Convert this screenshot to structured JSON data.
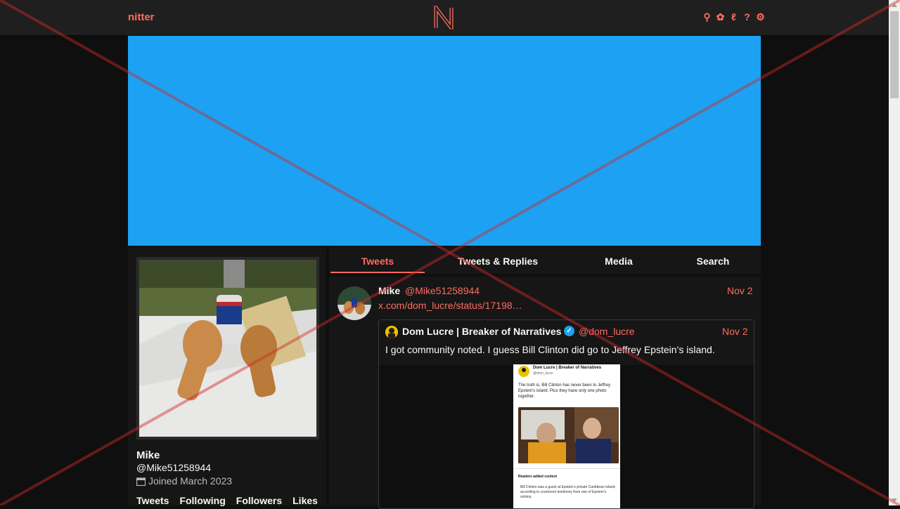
{
  "nav": {
    "brand": "nitter",
    "icons": [
      "search-icon",
      "bird-icon",
      "rss-icon",
      "help-icon",
      "gear-icon"
    ],
    "accent": "#ff6c60"
  },
  "banner": {
    "color": "#1da1f2"
  },
  "profile": {
    "name": "Mike",
    "handle": "@Mike51258944",
    "joined": "Joined March 2023",
    "stats": [
      "Tweets",
      "Following",
      "Followers",
      "Likes"
    ]
  },
  "tabs": [
    "Tweets",
    "Tweets & Replies",
    "Media",
    "Search"
  ],
  "tweet": {
    "name": "Mike",
    "handle": "@Mike51258944",
    "date": "Nov 2",
    "link": "x.com/dom_lucre/status/17198…",
    "quote": {
      "name": "Dom Lucre | Breaker of Narratives",
      "handle": "@dom_lucre",
      "date": "Nov 2",
      "text": "I got community noted. I guess Bill Clinton did go to Jeffrey Epstein’s island.",
      "media": {
        "name": "Dom Lucre | Breaker of Narratives",
        "handle": "@dom_lucre",
        "text": "The truth is, Bill Clinton has never been to Jeffrey Epstein’s island. Plus they have only one photo together.",
        "note_title": "Readers added context",
        "note": "Bill Clinton was a guest at Epstein’s private Caribbean Island, according to courtroom testimony from one of Epstein’s victims."
      }
    }
  }
}
